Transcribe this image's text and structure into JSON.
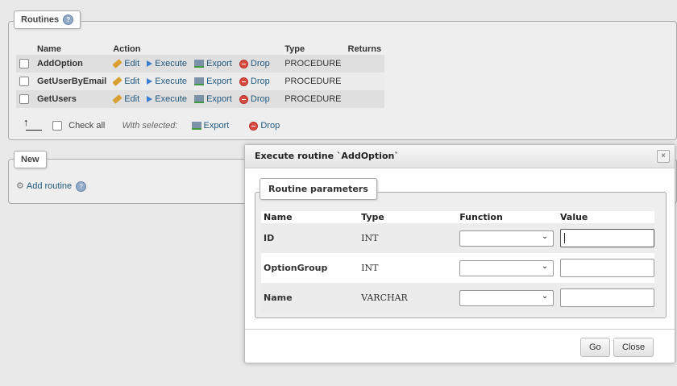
{
  "routines": {
    "legend": "Routines",
    "headers": {
      "name": "Name",
      "action": "Action",
      "type": "Type",
      "returns": "Returns"
    },
    "rows": [
      {
        "name": "AddOption",
        "edit": "Edit",
        "execute": "Execute",
        "export": "Export",
        "drop": "Drop",
        "type": "PROCEDURE",
        "returns": ""
      },
      {
        "name": "GetUserByEmail",
        "edit": "Edit",
        "execute": "Execute",
        "export": "Export",
        "drop": "Drop",
        "type": "PROCEDURE",
        "returns": ""
      },
      {
        "name": "GetUsers",
        "edit": "Edit",
        "execute": "Execute",
        "export": "Export",
        "drop": "Drop",
        "type": "PROCEDURE",
        "returns": ""
      }
    ],
    "check_all": "Check all",
    "with_selected": "With selected:",
    "bulk_export": "Export",
    "bulk_drop": "Drop"
  },
  "new_section": {
    "legend": "New",
    "add_routine": "Add routine"
  },
  "dialog": {
    "title": "Execute routine `AddOption`",
    "close_icon": "×",
    "params_legend": "Routine parameters",
    "headers": {
      "name": "Name",
      "type": "Type",
      "function": "Function",
      "value": "Value"
    },
    "params": [
      {
        "name": "ID",
        "type": "INT",
        "function": "",
        "value": ""
      },
      {
        "name": "OptionGroup",
        "type": "INT",
        "function": "",
        "value": ""
      },
      {
        "name": "Name",
        "type": "VARCHAR",
        "function": "",
        "value": ""
      }
    ],
    "go_label": "Go",
    "close_label": "Close"
  }
}
